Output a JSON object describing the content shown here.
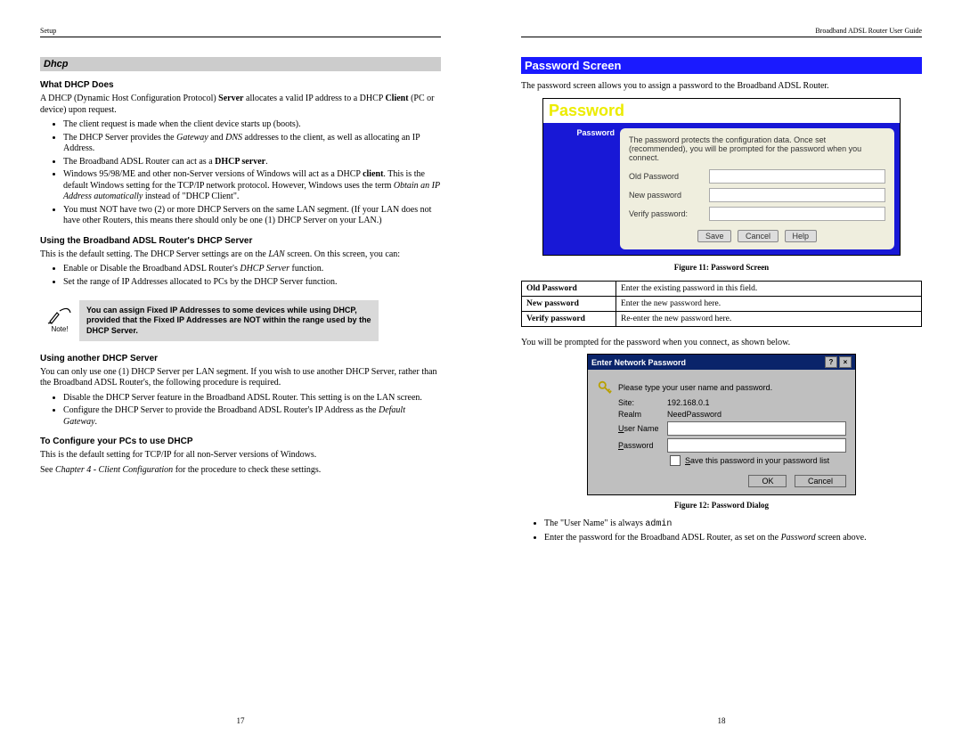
{
  "left": {
    "header_left": "Setup",
    "section_title": "Dhcp",
    "h1": "What DHCP Does",
    "p1_a": "A DHCP (Dynamic Host Configuration Protocol) ",
    "p1_b": "Server",
    "p1_c": " allocates a valid IP address to a DHCP ",
    "p1_d": "Client",
    "p1_e": " (PC or device) upon request.",
    "b1": "The client request is made when the client device starts up (boots).",
    "b2_a": "The DHCP Server provides the ",
    "b2_b": "Gateway",
    "b2_c": " and ",
    "b2_d": "DNS",
    "b2_e": " addresses to the client, as well as allocating an IP Address.",
    "b3_a": "The Broadband ADSL Router can act as a ",
    "b3_b": "DHCP server",
    "b3_c": ".",
    "b4_a": "Windows 95/98/ME and other non-Server versions of Windows will act as a DHCP ",
    "b4_b": "client",
    "b4_c": ". This is the default Windows setting for the TCP/IP network protocol. However, Windows uses the term ",
    "b4_d": "Obtain an IP Address automatically",
    "b4_e": " instead of \"DHCP Client\".",
    "b5": "You must NOT have two (2) or more DHCP Servers on the same LAN segment. (If your LAN does not have other Routers, this means there should only be one (1) DHCP Server on your LAN.)",
    "h2": "Using the Broadband ADSL Router's DHCP Server",
    "p2_a": "This is the default setting. The DHCP Server settings are on the ",
    "p2_b": "LAN",
    "p2_c": " screen. On this screen, you can:",
    "b6_a": "Enable or Disable the Broadband ADSL Router's ",
    "b6_b": "DHCP Server",
    "b6_c": " function.",
    "b7": "Set the range of IP Addresses allocated to PCs by the DHCP Server function.",
    "note_label": "Note!",
    "note": "You can assign Fixed IP Addresses to some devices while using DHCP, provided that the Fixed IP Addresses are NOT within the range used by the DHCP Server.",
    "h3": "Using another DHCP Server",
    "p3": "You can only use one (1) DHCP Server per LAN segment. If you wish to use another DHCP Server, rather than the Broadband ADSL Router's, the following procedure is required.",
    "b8": "Disable the DHCP Server feature in the Broadband ADSL Router. This setting is on the LAN screen.",
    "b9_a": "Configure the DHCP Server to provide the Broadband ADSL Router's IP Address as the ",
    "b9_b": "Default Gateway",
    "b9_c": ".",
    "h4": "To Configure your PCs to use DHCP",
    "p4": "This is the default setting for TCP/IP for all non-Server versions of Windows.",
    "p5_a": "See ",
    "p5_b": "Chapter 4 - Client Configuration",
    "p5_c": " for the procedure to check these settings.",
    "page_num": "17"
  },
  "right": {
    "header_right": "Broadband ADSL Router User Guide",
    "section_title": "Password Screen",
    "intro": "The password screen allows you to assign a password to the Broadband ADSL Router.",
    "pw_title": "Password",
    "pw_side": "Password",
    "pw_desc": "The password protects the configuration data. Once set (recommended), you will be prompted for the password when you connect.",
    "pw_old": "Old Password",
    "pw_new": "New password",
    "pw_verify": "Verify password:",
    "btn_save": "Save",
    "btn_cancel": "Cancel",
    "btn_help": "Help",
    "caption1": "Figure 11: Password Screen",
    "tbl": {
      "r1k": "Old Password",
      "r1v": "Enter the existing password in this field.",
      "r2k": "New password",
      "r2v": "Enter the new password here.",
      "r3k": "Verify password",
      "r3v": "Re-enter the new password here."
    },
    "p_prompt": "You will be prompted for the password when you connect, as shown below.",
    "dlg_title": "Enter Network Password",
    "dlg_msg": "Please type your user name and password.",
    "dlg_site_lbl": "Site:",
    "dlg_site_val": "192.168.0.1",
    "dlg_realm_lbl": "Realm",
    "dlg_realm_val": "NeedPassword",
    "dlg_user_lbl": "User Name",
    "dlg_user_u": "U",
    "dlg_pass_lbl": "Password",
    "dlg_pass_u": "P",
    "dlg_save_lbl": "Save this password in your password list",
    "dlg_save_u": "S",
    "dlg_ok": "OK",
    "dlg_cancel": "Cancel",
    "caption2": "Figure 12: Password Dialog",
    "b1_a": "The \"User Name\" is always ",
    "b1_b": "admin",
    "b2_a": "Enter the password for the Broadband ADSL Router, as set on the ",
    "b2_b": "Password",
    "b2_c": " screen above.",
    "page_num": "18"
  }
}
